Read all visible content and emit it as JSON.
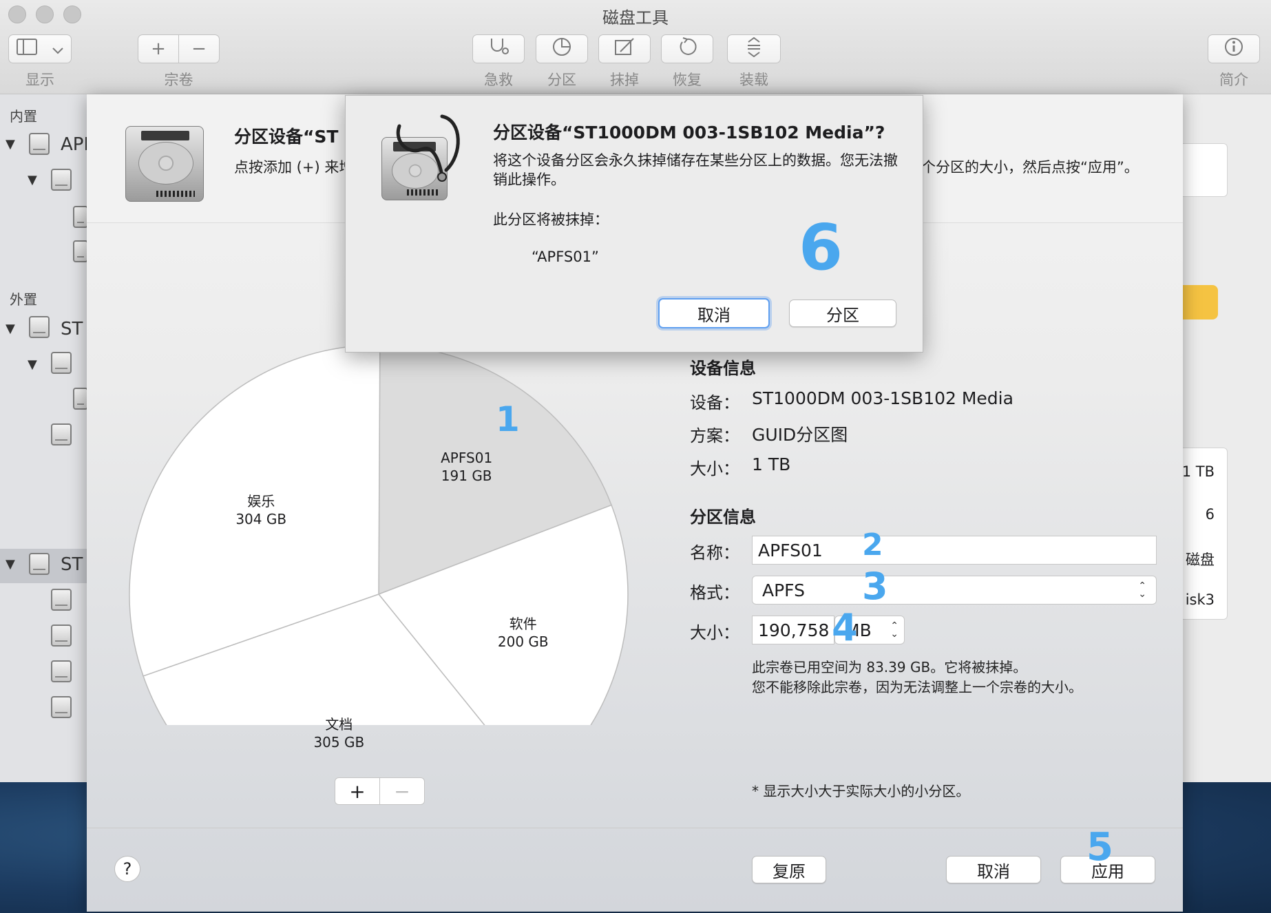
{
  "window": {
    "title": "磁盘工具"
  },
  "toolbar": {
    "view_label": "显示",
    "volume_label": "宗卷",
    "first_aid_label": "急救",
    "partition_label": "分区",
    "erase_label": "抹掉",
    "restore_label": "恢复",
    "mount_label": "装载",
    "info_label": "简介",
    "volume_add": "+",
    "volume_remove": "−"
  },
  "sidebar": {
    "internal_header": "内置",
    "external_header": "外置",
    "items": [
      {
        "label": "API"
      },
      {
        "label": "ST"
      },
      {
        "label": "ST"
      }
    ]
  },
  "right_panel": {
    "values": [
      "1 TB",
      "6",
      "磁盘",
      "isk3"
    ]
  },
  "sheet": {
    "title": "分区设备“ST",
    "desc_left": "点按添加 (+) 来增",
    "desc_right": "个分区的大小，然后点按“应用”。"
  },
  "pie": {
    "slices": [
      {
        "name": "APFS01",
        "size": "191 GB",
        "gb": 191,
        "color": "#dcdcdc"
      },
      {
        "name": "软件",
        "size": "200 GB",
        "gb": 200,
        "color": "#ffffff"
      },
      {
        "name": "文档",
        "size": "305 GB",
        "gb": 305,
        "color": "#ffffff"
      },
      {
        "name": "娱乐",
        "size": "304 GB",
        "gb": 304,
        "color": "#ffffff"
      }
    ],
    "add_button": "+",
    "remove_button": "−"
  },
  "device_info": {
    "title": "设备信息",
    "device_label": "设备：",
    "device_value": "ST1000DM 003-1SB102 Media",
    "scheme_label": "方案：",
    "scheme_value": "GUID分区图",
    "size_label": "大小：",
    "size_value": "1 TB"
  },
  "partition_info": {
    "title": "分区信息",
    "name_label": "名称：",
    "name_value": "APFS01",
    "format_label": "格式：",
    "format_value": "APFS",
    "size_label": "大小：",
    "size_value": "190,758",
    "size_unit": "MB",
    "note_line1": "此宗卷已用空间为 83.39 GB。它将被抹掉。",
    "note_line2": "您不能移除此宗卷，因为无法调整上一个宗卷的大小。",
    "small_note": "* 显示大小大于实际大小的小分区。"
  },
  "footer": {
    "help": "?",
    "revert": "复原",
    "cancel": "取消",
    "apply": "应用"
  },
  "alert": {
    "title": "分区设备“ST1000DM 003-1SB102 Media”?",
    "message": "将这个设备分区会永久抹掉储存在某些分区上的数据。您无法撤销此操作。",
    "sub": "此分区将被抹掉：",
    "volume": "“APFS01”",
    "cancel": "取消",
    "partition": "分区"
  },
  "annotations": [
    "1",
    "2",
    "3",
    "4",
    "5",
    "6"
  ]
}
